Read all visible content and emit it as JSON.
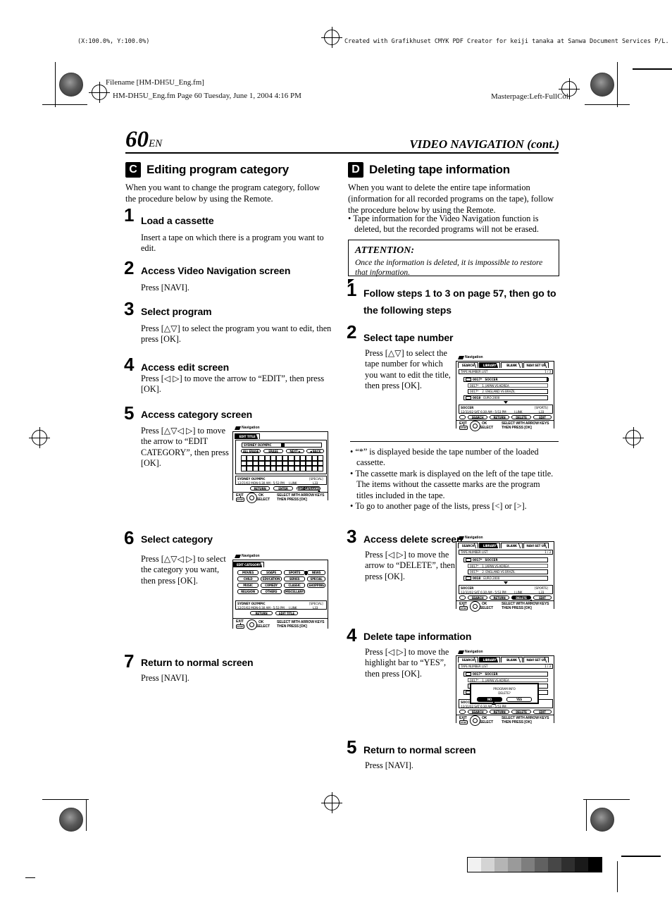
{
  "prepress": {
    "scale_note": "(X:100.0%, Y:100.0%)",
    "creator_note": "Created with Grafikhuset CMYK PDF Creator for keiji tanaka at Sanwa Document Services P/L.",
    "filename_label": "Filename [HM-DH5U_Eng.fm]",
    "file_stamp": "HM-DH5U_Eng.fm  Page 60  Tuesday, June 1, 2004  4:16 PM",
    "masterpage": "Masterpage:Left-FullCol",
    "grayscale_swatches": [
      "#f2f2f2",
      "#d4d4d4",
      "#b5b5b5",
      "#9a9a9a",
      "#7e7e7e",
      "#616161",
      "#474747",
      "#2f2f2f",
      "#1a1a1a",
      "#000000"
    ]
  },
  "page": {
    "number": "60",
    "number_suffix": "EN",
    "running_head": "VIDEO NAVIGATION (cont.)"
  },
  "left_section": {
    "badge": "C",
    "title": "Editing program category",
    "intro": "When you want to change the program category, follow the procedure below by using the Remote.",
    "steps": [
      {
        "num": "1",
        "head": "Load a cassette",
        "body": "Insert a tape on which there is a program you want to edit."
      },
      {
        "num": "2",
        "head": "Access Video Navigation screen",
        "body": "Press [NAVI]."
      },
      {
        "num": "3",
        "head": "Select program",
        "body": "Press [△▽] to select the program you want to edit, then press [OK]."
      },
      {
        "num": "4",
        "head": "Access edit screen",
        "body": "Press [◁ ▷] to move the arrow to “EDIT”, then press [OK]."
      },
      {
        "num": "5",
        "head": "Access category screen",
        "body": "Press [△▽◁ ▷] to move the arrow to “EDIT CATEGORY”, then press [OK]."
      },
      {
        "num": "6",
        "head": "Select category",
        "body": "Press [△▽◁ ▷] to select the category you want, then press [OK]."
      },
      {
        "num": "7",
        "head": "Return to normal screen",
        "body": "Press [NAVI]."
      }
    ]
  },
  "right_section": {
    "badge": "D",
    "title": "Deleting tape information",
    "intro": "When you want to delete the entire tape information (information for all recorded programs on the tape), follow the procedure below by using the Remote.",
    "intro_bullets": [
      "Tape information for the Video Navigation function is deleted, but the recorded programs will not be erased."
    ],
    "attention": {
      "title": "ATTENTION:",
      "body": "Once the information is deleted, it is impossible to restore that information."
    },
    "steps": [
      {
        "num": "1",
        "head": "Follow steps 1 to 3 on page 57, then go to the following steps",
        "body": ""
      },
      {
        "num": "2",
        "head": "Select tape number",
        "body": "Press [△▽] to select the tape number for which you want to edit the title, then press [OK]."
      },
      {
        "num": "3",
        "head": "Access delete screen",
        "body": "Press [◁ ▷] to move the arrow to “DELETE”, then press [OK]."
      },
      {
        "num": "4",
        "head": "Delete tape information",
        "body": "Press [◁ ▷] to move the highlight bar to “YES”, then press [OK]."
      },
      {
        "num": "5",
        "head": "Return to normal screen",
        "body": "Press [NAVI]."
      }
    ],
    "notes": [
      "“*” is displayed beside the tape number of the loaded cassette.",
      "The cassette mark is displayed on the left of the tape title. The items without the cassette marks are the program titles included in the tape.",
      "To go to another page of the lists, press [<] or [>]."
    ]
  },
  "osd_common": {
    "nav_label": "Navigation",
    "exit_label": "EXIT",
    "ok_label": "OK",
    "select_label": "SELECT",
    "stop_label": "STOP",
    "hint_line1": "SELECT WITH ARROW KEYS",
    "hint_line2": "THEN PRESS [OK]"
  },
  "osd_edit_title": {
    "tab": "EDIT TITLE",
    "title_value": "SYDNEY OLYMPIC",
    "keys": [
      "ALL ERASE",
      "ERASE",
      "NEXT ▶",
      "◀ BACK"
    ],
    "info_title": "SYDNEY OLYMPIC",
    "info_time": "12/21/02 MON    6:30 AM - 5:53 PM",
    "info_link": "I.LINK",
    "info_category": "[SPECIAL]",
    "info_code": "L33",
    "buttons": [
      "RETURN",
      "ENTER",
      "EDIT CATEGORY"
    ],
    "selected_button": "EDIT CATEGORY"
  },
  "osd_edit_category": {
    "tab": "EDIT CATEGORY",
    "categories": [
      [
        "MOVIES",
        "SOAPS",
        "SPORTS",
        "NEWS"
      ],
      [
        "CHILD",
        "EDUCATION",
        "SERIES",
        "SPECIAL"
      ],
      [
        "MUSIC",
        "COMEDY",
        "CLASSIC",
        "SHOPPING"
      ],
      [
        "RELIGION",
        "OTHERS",
        "MISCELLANY"
      ]
    ],
    "info_title": "SYDNEY OLYMPIC",
    "info_time": "12/21/02 MON    6:30 AM - 5:53 PM",
    "info_link": "I.LINK",
    "info_category": "[SPECIAL]",
    "info_code": "L33",
    "buttons": [
      "RETURN",
      "EDIT TITLE"
    ]
  },
  "osd_library": {
    "tabs": [
      "SEARCH",
      "LIBRARY",
      "BLANK",
      "NAVI SET UP"
    ],
    "selected_tab": "LIBRARY",
    "list_title": "TAPE NUMBER LIST",
    "page_indicator": "1 / 3",
    "rows": [
      {
        "num": "0017*",
        "title": "SOCCER",
        "cassette": true,
        "highlight": true
      },
      {
        "num": "0017*",
        "title": "1. JAPAN VS KOREA",
        "cassette": false,
        "highlight": false
      },
      {
        "num": "0017*",
        "title": "2. ENGLAND VS BRAZIL",
        "cassette": false,
        "highlight": false
      },
      {
        "num": "0018",
        "title": "EURO 2000",
        "cassette": true,
        "highlight": false
      }
    ],
    "info_title": "SOCCER",
    "info_time": "12/31/02 SAT    6:30 AM - 5:53 PM",
    "info_link": "I.LINK",
    "info_category": "[SPORTS]",
    "info_code": "L33",
    "buttons": [
      "SEARCH",
      "RETURN",
      "DELETE",
      "EDIT"
    ],
    "dialog": {
      "line1": "PROGRAM INFO",
      "line2": "DELETE?",
      "no_label": "NO",
      "yes_label": "YES",
      "selected": "NO"
    }
  }
}
